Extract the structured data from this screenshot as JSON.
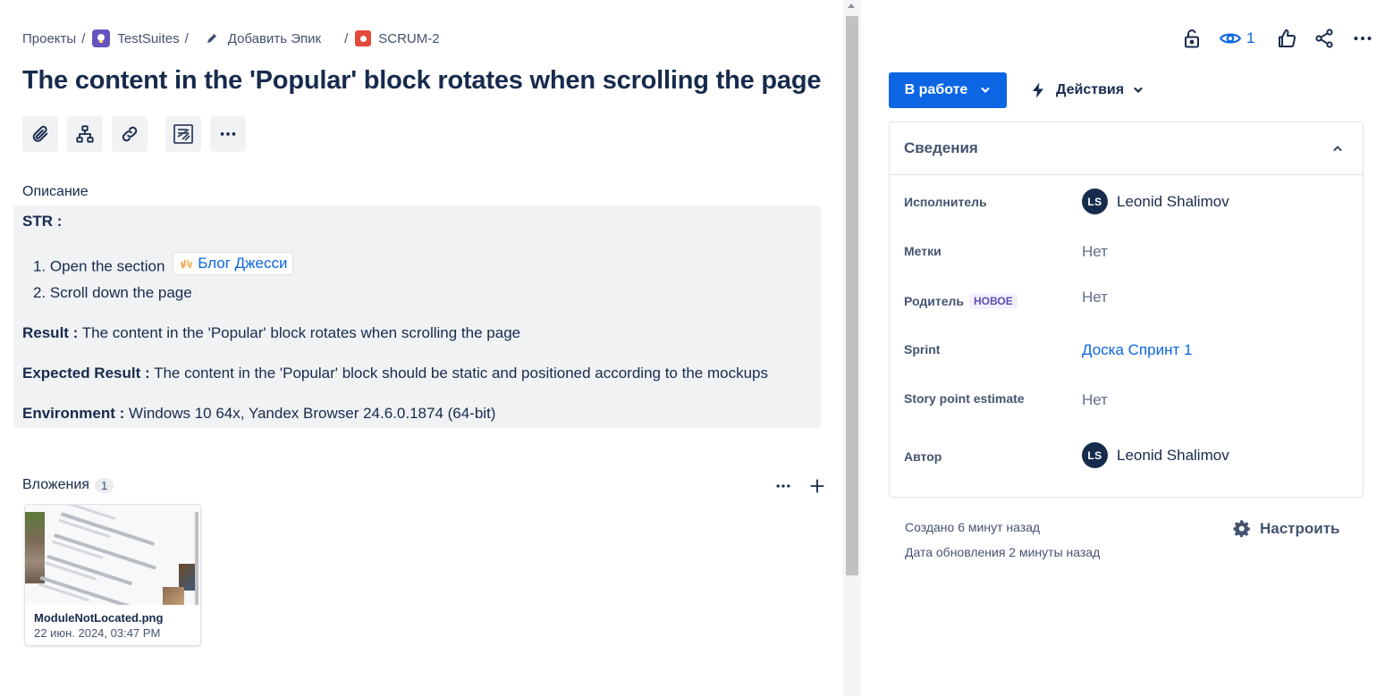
{
  "breadcrumb": {
    "projects": "Проекты",
    "suite": "TestSuites",
    "add_epic": "Добавить Эпик",
    "issue_key": "SCRUM-2"
  },
  "issue": {
    "title": "The content in the 'Popular' block rotates when scrolling the page"
  },
  "toolbar": {
    "attach_icon": "paperclip-icon",
    "child_icon": "hierarchy-icon",
    "link_icon": "link-icon",
    "apps_icon": "app-icon",
    "more_icon": "more-icon"
  },
  "description": {
    "label": "Описание",
    "str_label": "STR :",
    "step1_num": "1.",
    "step1_text": "Open the section",
    "step1_link": "Блог Джесси",
    "step2_num": "2.",
    "step2_text": "Scroll down the page",
    "result_label": "Result :",
    "result_text": "The content in the 'Popular' block rotates when scrolling the page",
    "expected_label": "Expected Result :",
    "expected_text": "The content in the 'Popular' block should be static and positioned according to the mockups",
    "env_label": "Environment :",
    "env_text": "Windows 10 64x, Yandex Browser 24.6.0.1874 (64-bit)"
  },
  "attachments": {
    "label": "Вложения",
    "count": "1",
    "files": [
      {
        "name": "ModuleNotLocated.png",
        "date": "22 июн. 2024, 03:47 PM"
      }
    ]
  },
  "header_actions": {
    "watch_count": "1"
  },
  "status": {
    "label": "В работе",
    "actions_label": "Действия"
  },
  "details": {
    "title": "Сведения",
    "assignee_label": "Исполнитель",
    "assignee_initials": "LS",
    "assignee_name": "Leonid Shalimov",
    "labels_label": "Метки",
    "labels_value": "Нет",
    "parent_label": "Родитель",
    "parent_badge": "НОВОЕ",
    "parent_value": "Нет",
    "sprint_label": "Sprint",
    "sprint_value": "Доска Спринт 1",
    "story_points_label": "Story point estimate",
    "story_points_value": "Нет",
    "reporter_label": "Автор",
    "reporter_initials": "LS",
    "reporter_name": "Leonid Shalimov"
  },
  "footer": {
    "created": "Создано 6 минут назад",
    "updated": "Дата обновления 2 минуты назад",
    "configure": "Настроить"
  },
  "colors": {
    "primary": "#0c66e4",
    "text": "#172b4d",
    "subtle": "#44546f",
    "bug": "#e5493a",
    "suite": "#6554c0"
  }
}
